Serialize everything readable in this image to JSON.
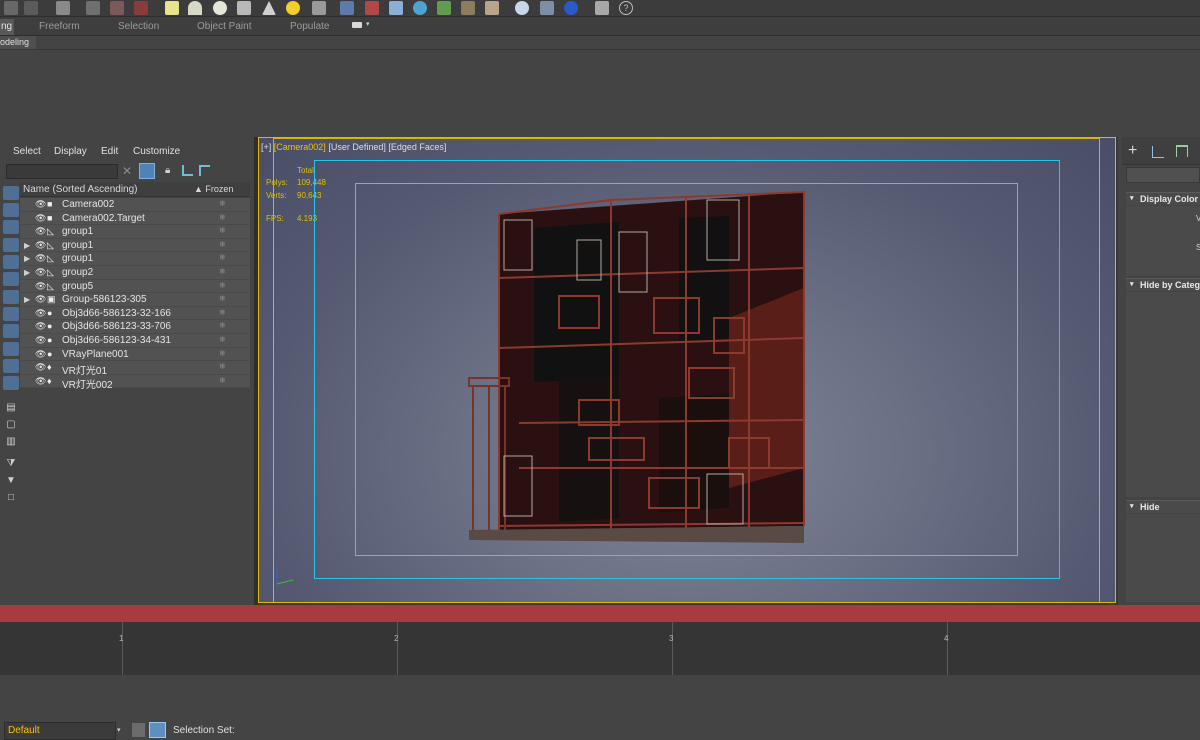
{
  "toolbar": {
    "icons": [
      "layers-icon",
      "grid-icon",
      "link-icon",
      "camera-icon",
      "render-icon",
      "rectangle-icon",
      "dome-icon",
      "sphere-icon",
      "teapot-icon",
      "cone-icon",
      "sun-icon",
      "omni-light-icon",
      "lattice-icon",
      "fractal-icon",
      "noise-icon",
      "globe-icon",
      "plant-icon",
      "tree-icon",
      "sculpt-icon",
      "material-sphere-icon",
      "pointer-icon",
      "settings-icon",
      "phone-icon",
      "help-icon"
    ]
  },
  "ribbon": {
    "active_tab": "ng",
    "tabs": [
      "Freeform",
      "Selection",
      "Object Paint",
      "Populate"
    ],
    "sub_label": "odeling"
  },
  "explorer": {
    "menu": [
      "Select",
      "Display",
      "Edit",
      "Customize"
    ],
    "header_name": "Name (Sorted Ascending)",
    "header_frozen": "▲ Frozen",
    "rows": [
      {
        "label": "Camera002",
        "expandable": false,
        "icon": "camera-icon"
      },
      {
        "label": "Camera002.Target",
        "expandable": false,
        "icon": "camera-icon"
      },
      {
        "label": "group1",
        "expandable": false,
        "icon": "helper-icon"
      },
      {
        "label": "group1",
        "expandable": true,
        "icon": "helper-icon"
      },
      {
        "label": "group1",
        "expandable": true,
        "icon": "helper-icon"
      },
      {
        "label": "group2",
        "expandable": true,
        "icon": "helper-icon"
      },
      {
        "label": "group5",
        "expandable": false,
        "icon": "helper-icon"
      },
      {
        "label": "Group-586123-305",
        "expandable": true,
        "icon": "group-icon"
      },
      {
        "label": "Obj3d66-586123-32-166",
        "expandable": false,
        "icon": "geometry-icon"
      },
      {
        "label": "Obj3d66-586123-33-706",
        "expandable": false,
        "icon": "geometry-icon"
      },
      {
        "label": "Obj3d66-586123-34-431",
        "expandable": false,
        "icon": "geometry-icon"
      },
      {
        "label": "VRayPlane001",
        "expandable": false,
        "icon": "geometry-icon"
      },
      {
        "label": "VR灯光01",
        "expandable": false,
        "icon": "light-icon"
      },
      {
        "label": "VR灯光002",
        "expandable": false,
        "icon": "light-icon"
      }
    ],
    "layer_value": "Default",
    "selection_set_label": "Selection Set:"
  },
  "viewport": {
    "label_prefix": "[+]",
    "camera": "[Camera002]",
    "view_mode": "[User Defined]",
    "shading": "[Edged Faces]",
    "stats": {
      "total_label": "Total",
      "polys_label": "Polys:",
      "polys_value": "109,448",
      "verts_label": "Verts:",
      "verts_value": "90,643",
      "fps_label": "FPS:",
      "fps_value": "4.193"
    }
  },
  "command_panel": {
    "rollouts": [
      "Display Color",
      "Hide by Catego",
      "Hide"
    ],
    "display_color_fragment_1": "V",
    "display_color_fragment_2": "S"
  },
  "timeline": {
    "ticks": [
      "1",
      "2",
      "3",
      "4"
    ]
  },
  "colors": {
    "accent_yellow": "#e2b800",
    "safe_frame_cyan": "#27c6e6",
    "timeline_red": "#a83b3f",
    "cabinet_wood": "#6a2a22"
  }
}
